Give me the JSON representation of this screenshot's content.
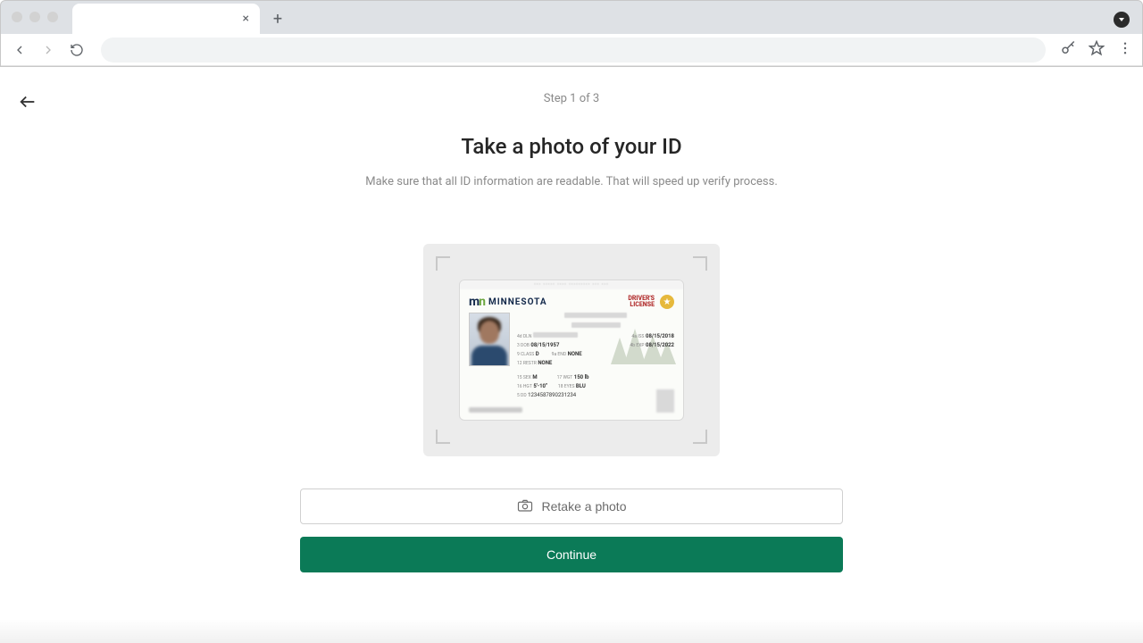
{
  "browser": {
    "tab_close_glyph": "×",
    "new_tab_glyph": "+"
  },
  "header": {
    "step_label": "Step 1 of 3",
    "title": "Take a photo of your ID",
    "subtitle": "Make sure that all ID information are readable. That will speed up verify process."
  },
  "id_card": {
    "top_strip_text": "••• ••••• •••• ••••••••• ••• •••",
    "state_logo_text": "m",
    "state_logo_text2": "n",
    "state_name": "MINNESOTA",
    "license_type_line1": "DRIVER'S",
    "license_type_line2": "LICENSE",
    "star_glyph": "★",
    "fields": {
      "dln_label": "4d DLN",
      "dob_label": "3  DOB",
      "dob_value": "08/15/1957",
      "class_label": "9  CLASS",
      "class_value": "D",
      "end_label": "9a END",
      "end_value": "NONE",
      "restr_label": "12 RESTR",
      "restr_value": "NONE",
      "iss_label": "4a ISS",
      "iss_value": "08/15/2018",
      "exp_label": "4b EXP",
      "exp_value": "08/15/2022",
      "sex_label": "15 SEX",
      "sex_value": "M",
      "wgt_label": "17 WGT",
      "wgt_value": "150 lb",
      "hgt_label": "16 HGT",
      "hgt_value": "5'-10\"",
      "eyes_label": "18 EYES",
      "eyes_value": "BLU",
      "dd_label": "5 DD",
      "dd_value": "1234587890231234"
    }
  },
  "buttons": {
    "retake_label": "Retake a photo",
    "continue_label": "Continue"
  },
  "colors": {
    "primary": "#0b7a57"
  }
}
